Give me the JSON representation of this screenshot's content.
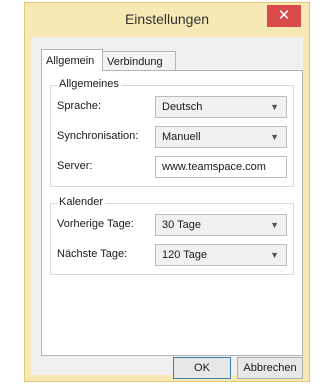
{
  "window": {
    "title": "Einstellungen",
    "close_glyph": "✕"
  },
  "tabs": [
    {
      "label": "Allgemein"
    },
    {
      "label": "Verbindung"
    }
  ],
  "general": {
    "title": "Allgemeines",
    "language": {
      "label": "Sprache:",
      "value": "Deutsch"
    },
    "sync": {
      "label": "Synchronisation:",
      "value": "Manuell"
    },
    "server": {
      "label": "Server:",
      "value": "www.teamspace.com"
    }
  },
  "calendar": {
    "title": "Kalender",
    "previous_days": {
      "label": "Vorherige Tage:",
      "value": "30 Tage"
    },
    "next_days": {
      "label": "Nächste Tage:",
      "value": "120 Tage"
    }
  },
  "buttons": {
    "ok": "OK",
    "cancel": "Abbrechen"
  },
  "icons": {
    "dropdown": "chevron-down-icon",
    "close": "close-icon"
  },
  "colors": {
    "frame": "#f6e9b4",
    "close_button": "#d94a4a"
  }
}
